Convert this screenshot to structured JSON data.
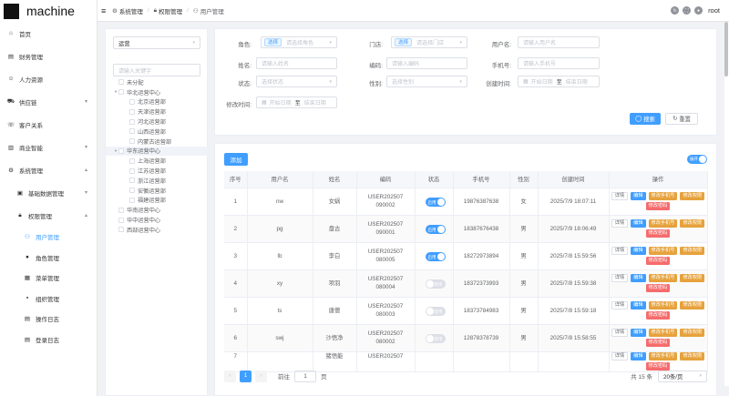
{
  "app": {
    "title": "machine"
  },
  "sidebar": {
    "items": [
      {
        "label": "首页",
        "icon": "home-icon"
      },
      {
        "label": "财务管理",
        "icon": "finance-icon"
      },
      {
        "label": "人力资源",
        "icon": "hr-icon"
      },
      {
        "label": "供应链",
        "icon": "supply-icon"
      },
      {
        "label": "客户关系",
        "icon": "customer-icon"
      },
      {
        "label": "商业智能",
        "icon": "bi-icon"
      },
      {
        "label": "系统管理",
        "icon": "gear-icon"
      },
      {
        "label": "基础数据管理",
        "icon": "data-icon"
      },
      {
        "label": "权限管理",
        "icon": "lock-icon"
      },
      {
        "label": "用户管理",
        "icon": "user-icon"
      },
      {
        "label": "角色管理",
        "icon": "role-icon"
      },
      {
        "label": "菜单管理",
        "icon": "menu-icon"
      },
      {
        "label": "组织管理",
        "icon": "org-icon"
      },
      {
        "label": "操作日志",
        "icon": "log-icon"
      },
      {
        "label": "登录日志",
        "icon": "login-log-icon"
      }
    ]
  },
  "header": {
    "breadcrumb": [
      "系统管理",
      "权限管理",
      "用户管理"
    ],
    "user": "root"
  },
  "org": {
    "select_value": "运营",
    "search_placeholder": "请输入关键字",
    "tree": [
      {
        "label": "未分配",
        "level": 1,
        "toggle": ""
      },
      {
        "label": "华北运营中心",
        "level": 1,
        "toggle": "▾"
      },
      {
        "label": "北京运营部",
        "level": 2,
        "toggle": ""
      },
      {
        "label": "天津运营部",
        "level": 2,
        "toggle": ""
      },
      {
        "label": "河北运营部",
        "level": 2,
        "toggle": ""
      },
      {
        "label": "山西运营部",
        "level": 2,
        "toggle": ""
      },
      {
        "label": "内蒙古运营部",
        "level": 2,
        "toggle": ""
      },
      {
        "label": "华东运营中心",
        "level": 1,
        "toggle": "▾"
      },
      {
        "label": "上海运营部",
        "level": 2,
        "toggle": ""
      },
      {
        "label": "江苏运营部",
        "level": 2,
        "toggle": ""
      },
      {
        "label": "浙江运营部",
        "level": 2,
        "toggle": ""
      },
      {
        "label": "安徽运营部",
        "level": 2,
        "toggle": ""
      },
      {
        "label": "福建运营部",
        "level": 2,
        "toggle": ""
      },
      {
        "label": "华南运营中心",
        "level": 1,
        "toggle": ""
      },
      {
        "label": "华中运营中心",
        "level": 1,
        "toggle": ""
      },
      {
        "label": "西部运营中心",
        "level": 1,
        "toggle": ""
      }
    ]
  },
  "search": {
    "role_label": "角色:",
    "role_tag": "选择",
    "role_placeholder": "请选择角色",
    "store_label": "门店:",
    "store_tag": "选择",
    "store_placeholder": "请选择门店",
    "username_label": "用户名:",
    "username_placeholder": "请输入用户名",
    "name_label": "姓名:",
    "name_placeholder": "请输入姓名",
    "code_label": "编码:",
    "code_placeholder": "请输入编码",
    "phone_label": "手机号:",
    "phone_placeholder": "请输入手机号",
    "status_label": "状态:",
    "status_placeholder": "选择状态",
    "gender_label": "性别:",
    "gender_placeholder": "选择性别",
    "created_label": "创建时间:",
    "created_start": "开始日期",
    "created_end": "结束日期",
    "modified_label": "修改时间:",
    "modified_start": "开始日期",
    "modified_to": "至",
    "modified_end": "结束日期",
    "created_to": "至",
    "search_button": "搜索",
    "reset_button": "重置"
  },
  "table": {
    "add_button": "添加",
    "toggle_label": "展开",
    "columns": [
      "序号",
      "用户名",
      "姓名",
      "编码",
      "状态",
      "手机号",
      "性别",
      "创建时间",
      "操作"
    ],
    "rows": [
      {
        "idx": "1",
        "username": "nw",
        "name": "女娲",
        "code": "USER202507090002",
        "status": "启用",
        "phone": "19876387638",
        "gender": "女",
        "created": "2025/7/9 18:07:11"
      },
      {
        "idx": "2",
        "username": "pg",
        "name": "盘古",
        "code": "USER202507090001",
        "status": "启用",
        "phone": "18387676438",
        "gender": "男",
        "created": "2025/7/9 18:06:49"
      },
      {
        "idx": "3",
        "username": "lb",
        "name": "李白",
        "code": "USER202507080005",
        "status": "启用",
        "phone": "18272973894",
        "gender": "男",
        "created": "2025/7/8 15:59:56"
      },
      {
        "idx": "4",
        "username": "xy",
        "name": "项羽",
        "code": "USER202507080004",
        "status": "禁用",
        "phone": "18372373993",
        "gender": "男",
        "created": "2025/7/8 15:59:38"
      },
      {
        "idx": "5",
        "username": "ts",
        "name": "唐僧",
        "code": "USER202507080003",
        "status": "禁用",
        "phone": "18373784983",
        "gender": "男",
        "created": "2025/7/8 15:59:18"
      },
      {
        "idx": "6",
        "username": "swj",
        "name": "沙悟净",
        "code": "USER202507080002",
        "status": "禁用",
        "phone": "12878378739",
        "gender": "男",
        "created": "2025/7/8 15:58:55"
      },
      {
        "idx": "7",
        "username": "",
        "name": "猪悟能",
        "code": "USER202507",
        "status": "",
        "phone": "",
        "gender": "",
        "created": ""
      }
    ],
    "ops": {
      "detail": "详情",
      "edit": "编辑",
      "edit_phone": "修改手机号",
      "edit_perm": "修改权限",
      "edit_pwd": "修改密码"
    }
  },
  "pager": {
    "prev": "‹",
    "page": "1",
    "next": "›",
    "goto_label": "前往",
    "goto_value": "1",
    "page_unit": "页",
    "total": "共 15 条",
    "page_size": "20条/页"
  }
}
